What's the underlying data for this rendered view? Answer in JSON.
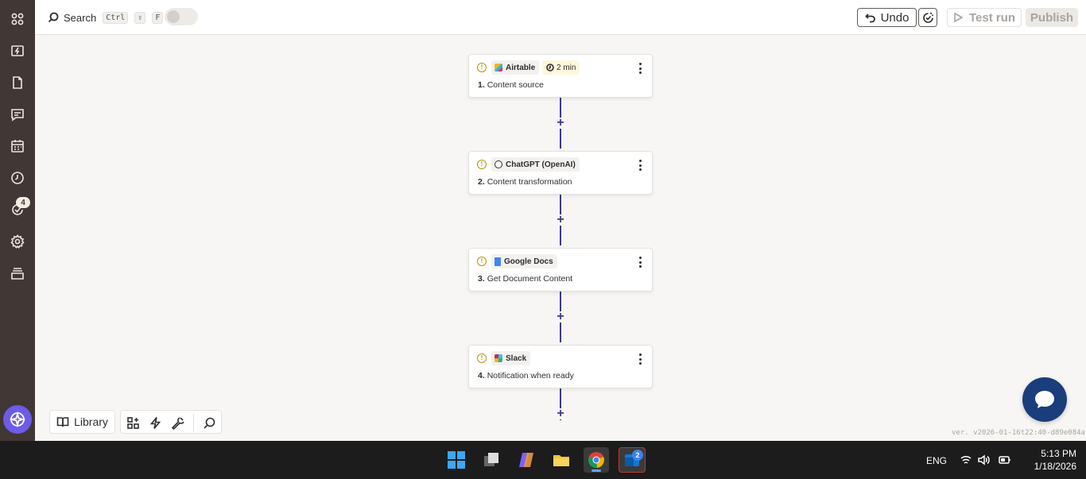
{
  "topbar": {
    "search_label": "Search",
    "shortcut_keys": [
      "Ctrl",
      "⇧",
      "F"
    ],
    "undo_label": "Undo",
    "test_run_label": "Test run",
    "publish_label": "Publish"
  },
  "rail": {
    "icons": [
      "apps-icon",
      "zaps-icon",
      "tables-icon",
      "interfaces-icon",
      "calendar-icon",
      "history-icon",
      "activity-icon",
      "settings-icon",
      "more-icon"
    ],
    "badge_count": "4"
  },
  "steps": [
    {
      "app": "Airtable",
      "number": "1.",
      "title": "Content source",
      "time": "2 min",
      "logo_color": "#fcb400"
    },
    {
      "app": "ChatGPT (OpenAI)",
      "number": "2.",
      "title": "Content transformation",
      "logo_color": "#2d2e2e"
    },
    {
      "app": "Google Docs",
      "number": "3.",
      "title": "Get Document Content",
      "logo_color": "#4285f4"
    },
    {
      "app": "Slack",
      "number": "4.",
      "title": "Notification when ready",
      "logo_color": "#e01e5a"
    }
  ],
  "bottom": {
    "library_label": "Library",
    "version": "ver. v2026-01-16t22:40-d89e084a"
  },
  "taskbar": {
    "language": "ENG",
    "time": "5:13 PM",
    "date": "1/18/2026",
    "outlook_badge": "2"
  },
  "colors": {
    "accent": "#3d3a8a",
    "rail_bg": "#413735",
    "chat_fab": "#1a3d7c"
  }
}
